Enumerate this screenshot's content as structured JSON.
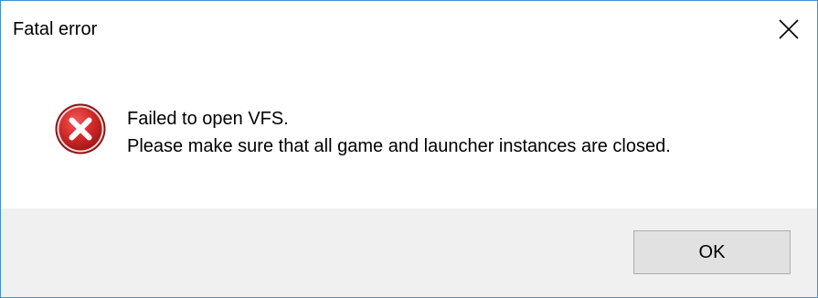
{
  "dialog": {
    "title": "Fatal error",
    "icon": "error-icon",
    "message_lines": [
      "Failed to open VFS.",
      "Please make sure that all game and launcher instances are closed."
    ],
    "ok_label": "OK",
    "close_icon": "close-icon"
  },
  "colors": {
    "window_border": "#3c8fd7",
    "footer_background": "#f0f0f0",
    "button_background": "#e1e1e1",
    "button_border": "#adadad",
    "error_red": "#c8202a"
  }
}
